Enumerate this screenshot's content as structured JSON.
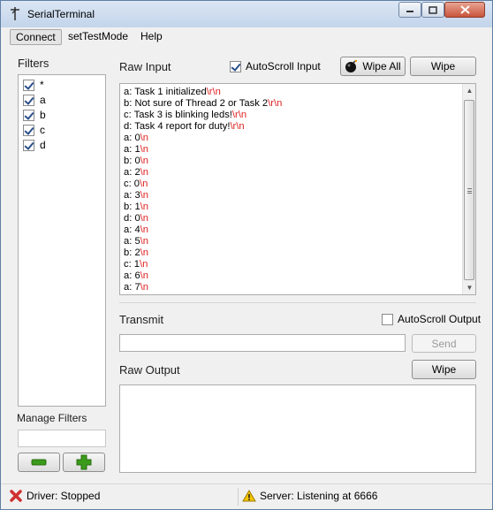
{
  "window": {
    "title": "SerialTerminal",
    "min_glyph": "▁",
    "max_glyph": "□",
    "close_glyph": "✕"
  },
  "menu": {
    "items": [
      "Connect",
      "setTestMode",
      "Help"
    ]
  },
  "filters": {
    "heading": "Filters",
    "items": [
      {
        "label": "*",
        "checked": true
      },
      {
        "label": "a",
        "checked": true
      },
      {
        "label": "b",
        "checked": true
      },
      {
        "label": "c",
        "checked": true
      },
      {
        "label": "d",
        "checked": true
      }
    ],
    "manage_label": "Manage Filters",
    "manage_input_value": "",
    "remove_button_icon": "minus-icon",
    "add_button_icon": "plus-icon",
    "remove_color": "#3a9a1a",
    "add_color": "#3a9a1a"
  },
  "raw_input": {
    "heading": "Raw Input",
    "autoscroll_label": "AutoScroll Input",
    "autoscroll_checked": true,
    "wipe_all_label": "Wipe All",
    "wipe_all_icon": "bomb-icon",
    "wipe_label": "Wipe",
    "lines": [
      {
        "text": "a: Task 1 initialized",
        "esc": "\\r\\n"
      },
      {
        "text": "b: Not sure of Thread 2 or Task 2",
        "esc": "\\r\\n"
      },
      {
        "text": "c: Task 3 is blinking leds!",
        "esc": "\\r\\n"
      },
      {
        "text": "d: Task 4 report for duty!",
        "esc": "\\r\\n"
      },
      {
        "text": "a: 0",
        "esc": "\\n"
      },
      {
        "text": "a: 1",
        "esc": "\\n"
      },
      {
        "text": "b: 0",
        "esc": "\\n"
      },
      {
        "text": "a: 2",
        "esc": "\\n"
      },
      {
        "text": "c: 0",
        "esc": "\\n"
      },
      {
        "text": "a: 3",
        "esc": "\\n"
      },
      {
        "text": "b: 1",
        "esc": "\\n"
      },
      {
        "text": "d: 0",
        "esc": "\\n"
      },
      {
        "text": "a: 4",
        "esc": "\\n"
      },
      {
        "text": "a: 5",
        "esc": "\\n"
      },
      {
        "text": "b: 2",
        "esc": "\\n"
      },
      {
        "text": "c: 1",
        "esc": "\\n"
      },
      {
        "text": "a: 6",
        "esc": "\\n"
      },
      {
        "text": "a: 7",
        "esc": "\\n"
      }
    ],
    "escape_color": "#e02020",
    "scroll_up_glyph": "▲",
    "scroll_down_glyph": "▼"
  },
  "transmit": {
    "heading": "Transmit",
    "autoscroll_label": "AutoScroll Output",
    "autoscroll_checked": false,
    "input_value": "",
    "send_label": "Send"
  },
  "raw_output": {
    "heading": "Raw Output",
    "wipe_label": "Wipe",
    "content": ""
  },
  "status": {
    "driver_text": "Driver: Stopped",
    "driver_icon": "error-x-icon",
    "driver_color": "#d03030",
    "server_text": "Server: Listening at 6666",
    "server_icon": "warning-icon",
    "server_color": "#e8b400"
  }
}
